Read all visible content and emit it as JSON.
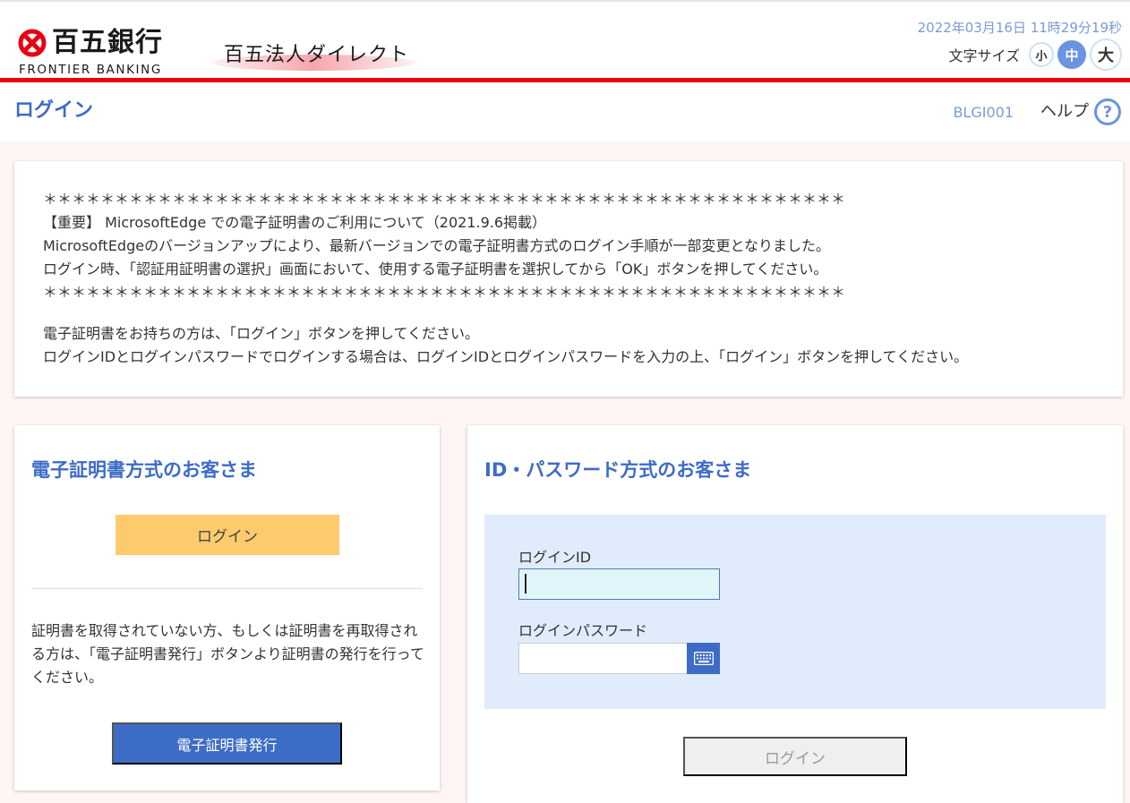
{
  "header": {
    "bank_name": "百五銀行",
    "bank_sub": "FRONTIER BANKING",
    "service_name": "百五法人ダイレクト",
    "datetime": "2022年03月16日 11時29分19秒",
    "font_size_label": "文字サイズ",
    "font_size_options": [
      "小",
      "中",
      "大"
    ],
    "font_size_selected": "中"
  },
  "titlebar": {
    "title": "ログイン",
    "screen_id": "BLGI001",
    "help_label": "ヘルプ",
    "help_icon_glyph": "?"
  },
  "notice": {
    "lines": [
      "＊＊＊＊＊＊＊＊＊＊＊＊＊＊＊＊＊＊＊＊＊＊＊＊＊＊＊＊＊＊＊＊＊＊＊＊＊＊＊＊＊＊＊＊＊＊＊＊＊＊＊＊＊＊＊＊",
      "【重要】 MicrosoftEdge での電子証明書のご利用について（2021.9.6掲載）",
      "MicrosoftEdgeのバージョンアップにより、最新バージョンでの電子証明書方式のログイン手順が一部変更となりました。",
      "ログイン時、「認証用証明書の選択」画面において、使用する電子証明書を選択してから「OK」ボタンを押してください。",
      "＊＊＊＊＊＊＊＊＊＊＊＊＊＊＊＊＊＊＊＊＊＊＊＊＊＊＊＊＊＊＊＊＊＊＊＊＊＊＊＊＊＊＊＊＊＊＊＊＊＊＊＊＊＊＊＊"
    ],
    "instructions": [
      "電子証明書をお持ちの方は、「ログイン」ボタンを押してください。",
      "ログインIDとログインパスワードでログインする場合は、ログインIDとログインパスワードを入力の上、「ログイン」ボタンを押してください。"
    ]
  },
  "cert_panel": {
    "title": "電子証明書方式のお客さま",
    "login_button": "ログイン",
    "description": "証明書を取得されていない方、もしくは証明書を再取得される方は、「電子証明書発行」ボタンより証明書の発行を行ってください。",
    "issue_button": "電子証明書発行"
  },
  "id_panel": {
    "title": "ID・パスワード方式のお客さま",
    "login_id_label": "ログインID",
    "login_id_value": "",
    "password_label": "ログインパスワード",
    "password_value": "",
    "keyboard_icon": "software-keyboard-icon",
    "login_button": "ログイン"
  },
  "colors": {
    "accent_blue": "#3d6cc6",
    "brand_red": "#e60012",
    "cert_login_yellow": "#fdcb6e",
    "form_bg": "#e0ebfb",
    "page_bg": "#fff5f4"
  }
}
